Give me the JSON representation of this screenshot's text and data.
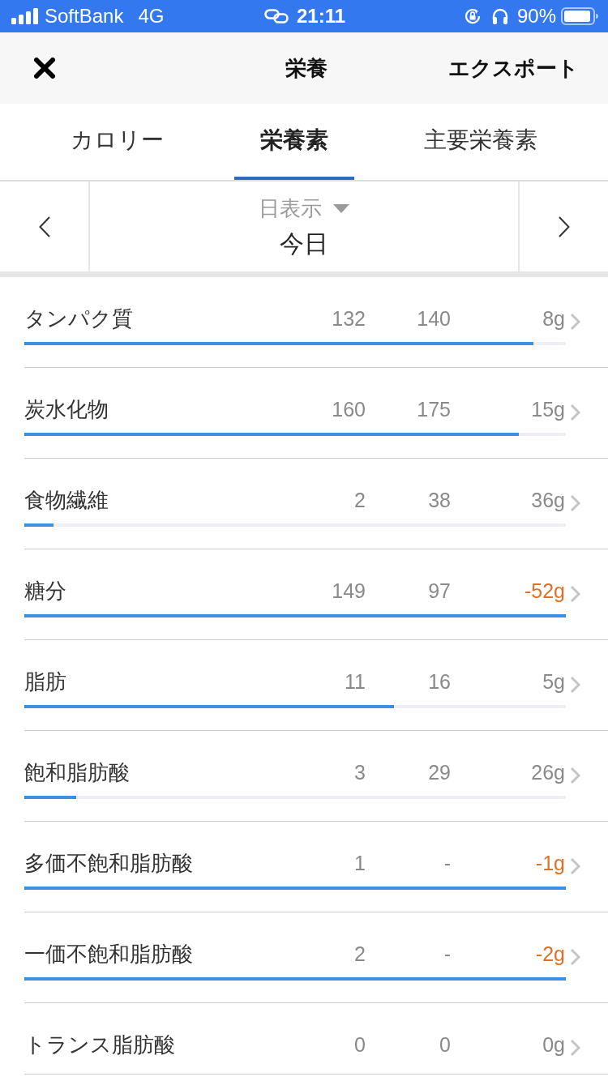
{
  "status_bar": {
    "carrier": "SoftBank",
    "network": "4G",
    "time": "21:11",
    "battery": "90%"
  },
  "header": {
    "title": "栄養",
    "action": "エクスポート"
  },
  "tabs": [
    {
      "label": "カロリー",
      "selected": false
    },
    {
      "label": "栄養素",
      "selected": true
    },
    {
      "label": "主要栄養素",
      "selected": false
    }
  ],
  "date_nav": {
    "view": "日表示",
    "date": "今日"
  },
  "nutrients": [
    {
      "name": "タンパク質",
      "values": [
        "132",
        "140",
        "8g"
      ],
      "level": 0.94,
      "over": false
    },
    {
      "name": "炭水化物",
      "values": [
        "160",
        "175",
        "15g"
      ],
      "level": 0.913,
      "over": false
    },
    {
      "name": "食物繊維",
      "values": [
        "2",
        "38",
        "36g"
      ],
      "level": 0.054,
      "over": false
    },
    {
      "name": "糖分",
      "values": [
        "149",
        "97",
        "-52g"
      ],
      "level": 1,
      "over": true
    },
    {
      "name": "脂肪",
      "values": [
        "11",
        "16",
        "5g"
      ],
      "level": 0.683,
      "over": false
    },
    {
      "name": "飽和脂肪酸",
      "values": [
        "3",
        "29",
        "26g"
      ],
      "level": 0.096,
      "over": false
    },
    {
      "name": "多価不飽和脂肪酸",
      "values": [
        "1",
        "-",
        "-1g"
      ],
      "level": 1,
      "over": true
    },
    {
      "name": "一価不飽和脂肪酸",
      "values": [
        "2",
        "-",
        "-2g"
      ],
      "level": 1,
      "over": true
    },
    {
      "name": "トランス脂肪酸",
      "values": [
        "0",
        "0",
        "0g"
      ],
      "over": false
    }
  ]
}
